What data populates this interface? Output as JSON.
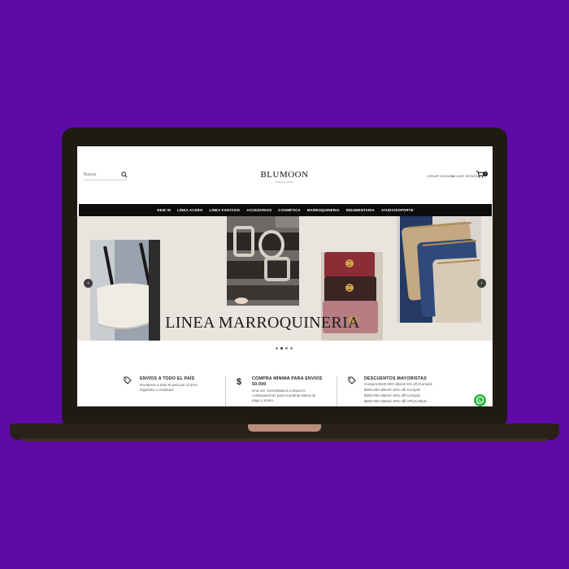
{
  "header": {
    "search_placeholder": "Buscar",
    "logo_name": "BLUMOON",
    "logo_tagline": "SINCE 2019",
    "create_account": "CREAR CUENTA",
    "login": "INICIAR SESIÓN",
    "cart_count": "0"
  },
  "nav": {
    "items": [
      "NEW IN",
      "LÍNEA ACERO",
      "LÍNEA FANTASÍA",
      "ACCESORIOS",
      "COSMÉTICA",
      "MARROQUINERIA",
      "INDUMENTARIA",
      "AYUDA/SOPORTE"
    ]
  },
  "hero": {
    "title": "LINEA MARROQUINERIA",
    "slide_count": 4,
    "active_slide": 2
  },
  "features": [
    {
      "icon": "tag-icon",
      "title": "ENVÍOS A TODO EL PAÍS",
      "lines": [
        "Enviamos a todo el país por Correo",
        "argentino o Andreani"
      ]
    },
    {
      "icon": "dollar-icon",
      "title": "COMPRA MÍNIMA PARA ENVÍOS",
      "title2": "50.000",
      "lines": [
        "Una vez concretada la compra le",
        "contactaremos para coordinar datos de",
        "pago y envío."
      ]
    },
    {
      "icon": "tag-icon",
      "title": "DESCUENTOS MAYORISTAS",
      "lines": [
        "Comprá $100.000 obtené 5% off /Comprá",
        "$200.000 obtené 10% off/ Comprá",
        "$300.000 obtené 15% off/ Comprá",
        "$500.000 obtené 20% off/ APLICABLE"
      ]
    }
  ],
  "colors": {
    "background": "#5e0ba6",
    "nav": "#0c0c0c",
    "hero_bg": "#e9e5de",
    "whatsapp": "#2cb742"
  }
}
